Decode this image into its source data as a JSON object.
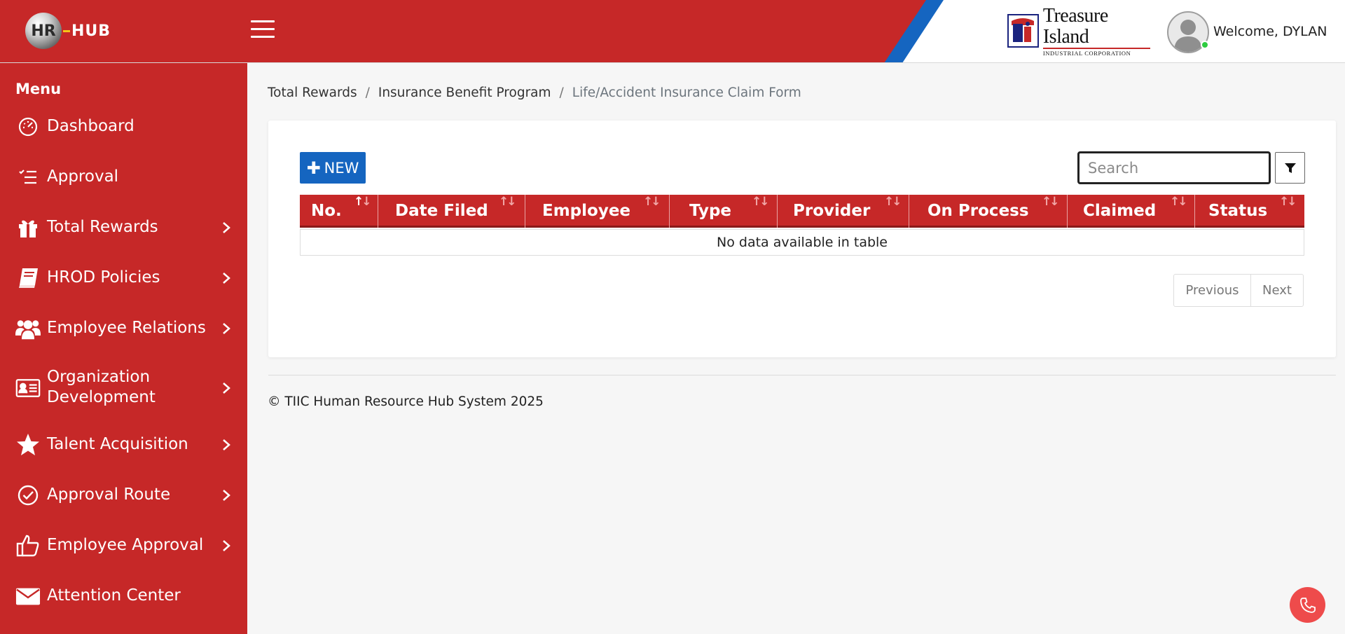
{
  "app": {
    "logo_hr": "HR",
    "logo_hub": "HUB",
    "company_name": "Treasure Island",
    "company_sub": "INDUSTRIAL CORPORATION",
    "welcome": "Welcome, DYLAN"
  },
  "sidebar": {
    "title": "Menu",
    "items": [
      {
        "label": "Dashboard",
        "icon": "dashboard-gauge-icon",
        "has_submenu": false
      },
      {
        "label": "Approval",
        "icon": "checklist-icon",
        "has_submenu": false
      },
      {
        "label": "Total Rewards",
        "icon": "gift-icon",
        "has_submenu": true
      },
      {
        "label": "HROD Policies",
        "icon": "book-icon",
        "has_submenu": true
      },
      {
        "label": "Employee Relations",
        "icon": "users-icon",
        "has_submenu": true
      },
      {
        "label": "Organization Development",
        "icon": "id-card-icon",
        "has_submenu": true
      },
      {
        "label": "Talent Acquisition",
        "icon": "star-icon",
        "has_submenu": true
      },
      {
        "label": "Approval Route",
        "icon": "check-circle-icon",
        "has_submenu": true
      },
      {
        "label": "Employee Approval",
        "icon": "thumbs-up-icon",
        "has_submenu": true
      },
      {
        "label": "Attention Center",
        "icon": "envelope-icon",
        "has_submenu": false
      }
    ]
  },
  "breadcrumb": {
    "items": [
      "Total Rewards",
      "Insurance Benefit Program",
      "Life/Accident Insurance Claim Form"
    ],
    "separator": "/"
  },
  "toolbar": {
    "new_label": "NEW",
    "search_placeholder": "Search"
  },
  "table": {
    "columns": [
      "No.",
      "Date Filed",
      "Employee",
      "Type",
      "Provider",
      "On Process",
      "Claimed",
      "Status"
    ],
    "sorted_column": "No.",
    "empty_message": "No data available in table"
  },
  "pagination": {
    "previous": "Previous",
    "next": "Next"
  },
  "footer": {
    "text": "© TIIC Human Resource Hub System 2025"
  },
  "colors": {
    "primary_red": "#c62828",
    "accent_blue": "#1565c0",
    "call_button": "#ee4b4b"
  }
}
